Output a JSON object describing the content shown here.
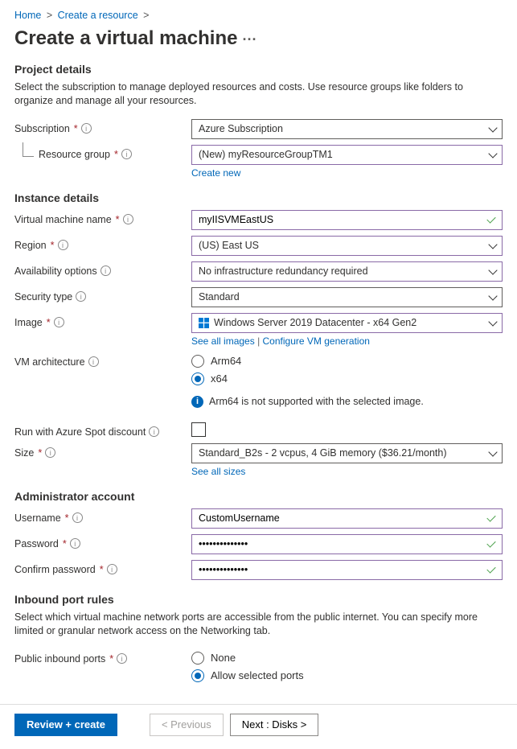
{
  "breadcrumb": {
    "home": "Home",
    "create_resource": "Create a resource"
  },
  "page_title": "Create a virtual machine",
  "project_details": {
    "heading": "Project details",
    "desc": "Select the subscription to manage deployed resources and costs. Use resource groups like folders to organize and manage all your resources.",
    "subscription_label": "Subscription",
    "subscription_value": "Azure Subscription",
    "resource_group_label": "Resource group",
    "resource_group_value": "(New) myResourceGroupTM1",
    "create_new": "Create new"
  },
  "instance_details": {
    "heading": "Instance details",
    "vm_name_label": "Virtual machine name",
    "vm_name_value": "myIISVMEastUS",
    "region_label": "Region",
    "region_value": "(US) East US",
    "availability_label": "Availability options",
    "availability_value": "No infrastructure redundancy required",
    "security_label": "Security type",
    "security_value": "Standard",
    "image_label": "Image",
    "image_value": "Windows Server 2019 Datacenter - x64 Gen2",
    "see_all_images": "See all images",
    "configure_gen": "Configure VM generation",
    "arch_label": "VM architecture",
    "arch_arm64": "Arm64",
    "arch_x64": "x64",
    "arch_note": "Arm64 is not supported with the selected image.",
    "spot_label": "Run with Azure Spot discount",
    "size_label": "Size",
    "size_value": "Standard_B2s - 2 vcpus, 4 GiB memory ($36.21/month)",
    "see_all_sizes": "See all sizes"
  },
  "admin": {
    "heading": "Administrator account",
    "username_label": "Username",
    "username_value": "CustomUsername",
    "password_label": "Password",
    "password_value": "••••••••••••••",
    "confirm_label": "Confirm password",
    "confirm_value": "••••••••••••••"
  },
  "inbound": {
    "heading": "Inbound port rules",
    "desc": "Select which virtual machine network ports are accessible from the public internet. You can specify more limited or granular network access on the Networking tab.",
    "ports_label": "Public inbound ports",
    "none": "None",
    "allow": "Allow selected ports"
  },
  "footer": {
    "review": "Review + create",
    "previous": "< Previous",
    "next": "Next : Disks >"
  }
}
